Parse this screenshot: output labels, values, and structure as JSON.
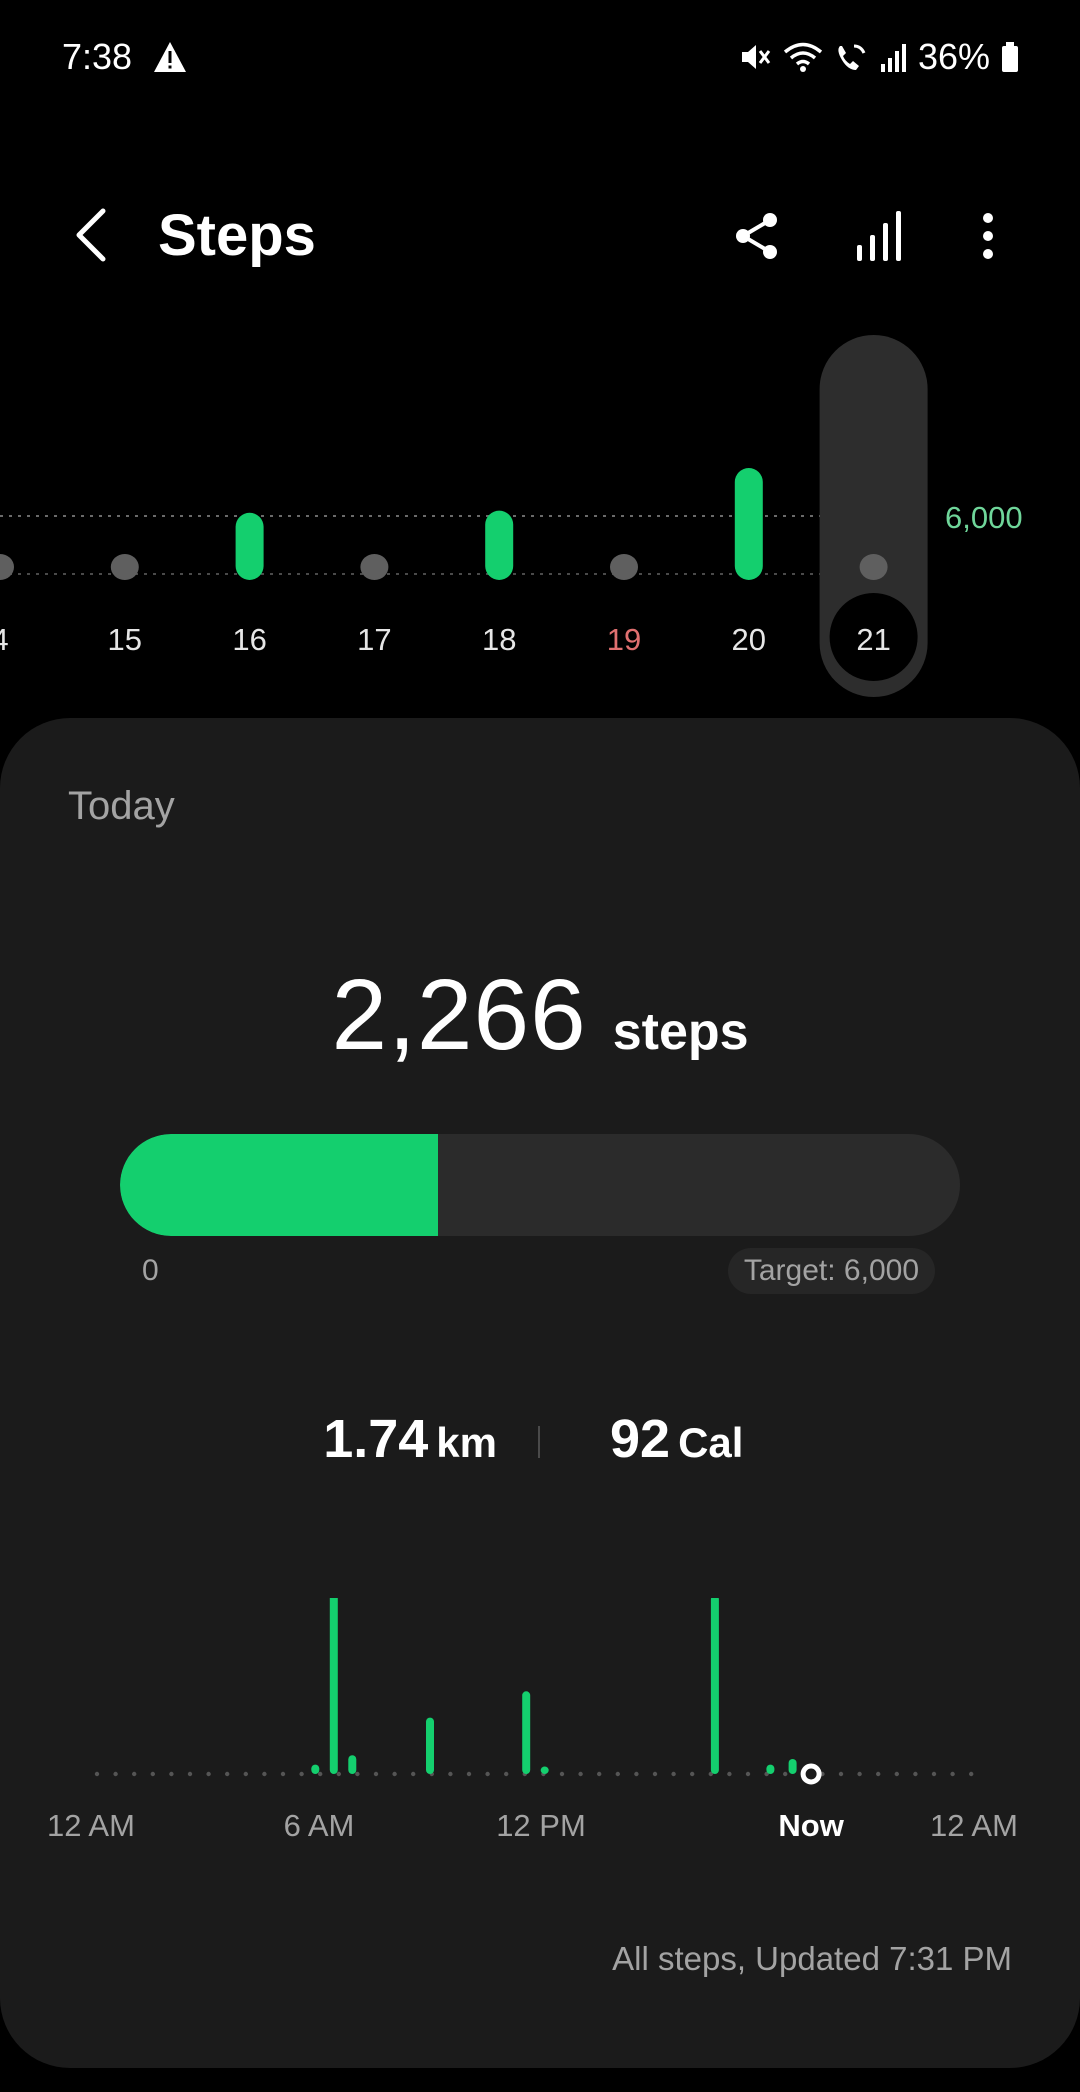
{
  "status_bar": {
    "time": "7:38",
    "battery": "36%",
    "icons": [
      "warning-icon",
      "mute-icon",
      "wifi-icon",
      "wifi-call-icon",
      "signal-icon",
      "battery-icon"
    ]
  },
  "header": {
    "title": "Steps",
    "actions": [
      "back-icon",
      "share-icon",
      "bar-chart-icon",
      "more-icon"
    ]
  },
  "week": {
    "goal": 6000,
    "goal_label": "6,000",
    "selected": "21",
    "days": [
      {
        "label": "4",
        "steps": 500,
        "met": false,
        "weekend": false
      },
      {
        "label": "15",
        "steps": 1200,
        "met": false,
        "weekend": false
      },
      {
        "label": "16",
        "steps": 6300,
        "met": true,
        "weekend": false
      },
      {
        "label": "17",
        "steps": 400,
        "met": false,
        "weekend": false
      },
      {
        "label": "18",
        "steps": 6500,
        "met": true,
        "weekend": false
      },
      {
        "label": "19",
        "steps": 1500,
        "met": false,
        "weekend": true
      },
      {
        "label": "20",
        "steps": 10500,
        "met": true,
        "weekend": false
      },
      {
        "label": "21",
        "steps": 300,
        "met": false,
        "weekend": false
      }
    ]
  },
  "today": {
    "label": "Today",
    "steps": "2,266",
    "steps_unit": "steps",
    "progress_fraction": 0.378,
    "range_min": "0",
    "target": "Target: 6,000",
    "distance": "1.74",
    "distance_unit": "km",
    "calories": "92",
    "calories_unit": "Cal",
    "updated": "All steps, Updated 7:31 PM"
  },
  "chart_data": {
    "type": "bar",
    "x_ticks": [
      "12 AM",
      "6 AM",
      "12 PM",
      "Now",
      "12 AM"
    ],
    "x_tick_hours": [
      0,
      6,
      12,
      19.3,
      24
    ],
    "now_hour": 19.3,
    "bars": [
      {
        "hour": 5.9,
        "value": 5
      },
      {
        "hour": 6.4,
        "value": 100
      },
      {
        "hour": 6.9,
        "value": 10
      },
      {
        "hour": 9.0,
        "value": 30
      },
      {
        "hour": 11.6,
        "value": 44
      },
      {
        "hour": 12.1,
        "value": 4
      },
      {
        "hour": 16.7,
        "value": 95
      },
      {
        "hour": 18.2,
        "value": 5
      },
      {
        "hour": 18.8,
        "value": 8
      }
    ],
    "colors": {
      "bar": "#14cf6e",
      "baseline": "#555555"
    }
  },
  "colors": {
    "accent": "#14cf6e",
    "inactive": "#5f5f5f",
    "weekend": "#e07070",
    "card": "#1b1b1b"
  }
}
